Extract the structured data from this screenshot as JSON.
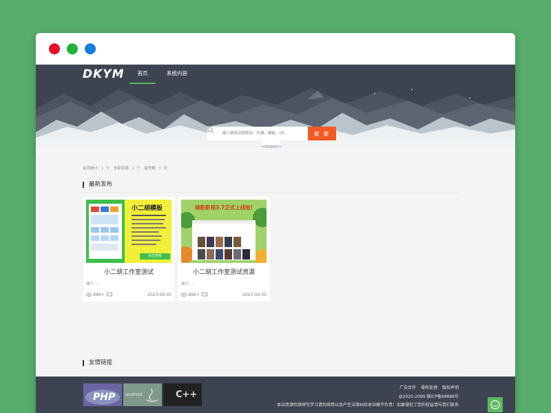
{
  "window": {
    "controls": [
      "close",
      "minimize",
      "maximize"
    ]
  },
  "nav": {
    "logo": "DKYM",
    "items": [
      {
        "label": "首页",
        "active": true
      },
      {
        "label": "系统内容",
        "active": false
      }
    ]
  },
  "search": {
    "placeholder": "输入精简词搜索如：约课、模板、DK",
    "button": "搜 索"
  },
  "stats": {
    "members_label": "会员统计:",
    "members_count": "1",
    "members_unit": "个",
    "resources_label": "全部资源:",
    "resources_count": "2",
    "resources_unit": "个",
    "comments_label": "留言数:",
    "comments_count": "0",
    "comments_unit": "次"
  },
  "latest": {
    "title": "最新发布",
    "cards": [
      {
        "title": "小二胡工作室测试",
        "desc": "简介: ...",
        "views": "999+",
        "date": "2023-04-05",
        "thumb_heading": "小二胡模板",
        "thumb_button": "点击查看"
      },
      {
        "title": "小二胡工作室测试资源",
        "desc": "简介: ...",
        "views": "999+",
        "date": "2023-04-05",
        "thumb_heading": "绿影影视3.7正式上线啦!"
      }
    ]
  },
  "friend_links": {
    "title": "友情链接",
    "logos": [
      "PHP",
      "android",
      "C++"
    ]
  },
  "footer": {
    "links": [
      "广告合作",
      "侵权处理",
      "版权声明"
    ],
    "copyright": "@2020-2099 冀ICP备88888号",
    "disclaimer": "本站资源仅供研究学习请勿商用以及产生法律纠纷本站概不负责！如果侵犯了您的权益请与我们联系"
  },
  "colors": {
    "page_bg": "#58ad6c",
    "nav_bg": "#3d4350",
    "accent_green": "#5fb85f",
    "search_button": "#f45a24",
    "count_orange": "#f08a2c"
  },
  "icons": [
    "search-icon",
    "eye-icon",
    "comment-icon",
    "chat-icon"
  ]
}
